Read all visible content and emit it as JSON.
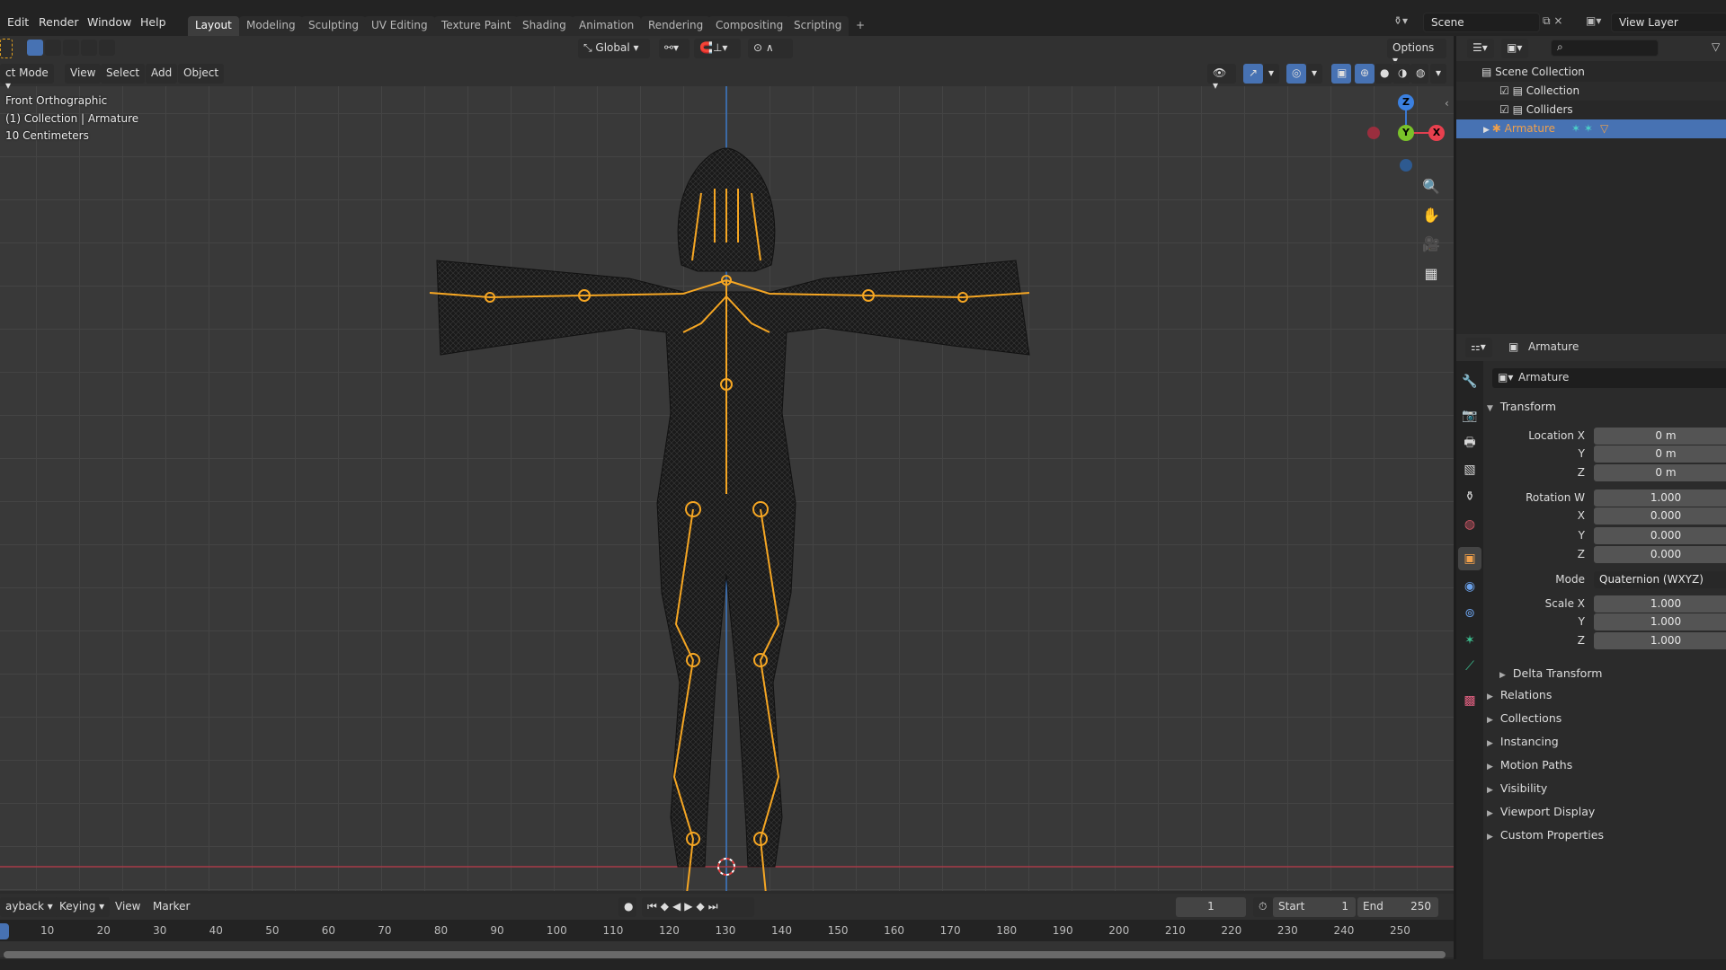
{
  "menus": [
    "Edit",
    "Render",
    "Window",
    "Help"
  ],
  "workspaces": [
    "Layout",
    "Modeling",
    "Sculpting",
    "UV Editing",
    "Texture Paint",
    "Shading",
    "Animation",
    "Rendering",
    "Compositing",
    "Scripting",
    "+"
  ],
  "active_workspace": "Layout",
  "scene": {
    "name": "Scene",
    "view_layer": "View Layer"
  },
  "toolbar": {
    "orientation": "Global",
    "options": "Options"
  },
  "viewport_header": {
    "mode": "ct Mode",
    "menus": [
      "View",
      "Select",
      "Add",
      "Object"
    ]
  },
  "viewport_overlay": {
    "view": "Front Orthographic",
    "collection": "(1) Collection | Armature",
    "scale": "10 Centimeters"
  },
  "gizmo": {
    "z": "Z",
    "y": "Y",
    "x": "X"
  },
  "timeline": {
    "menus": [
      "ayback",
      "Keying",
      "View",
      "Marker"
    ],
    "current_frame": "1",
    "start_label": "Start",
    "start": "1",
    "end_label": "End",
    "end": "250",
    "ticks": [
      "10",
      "20",
      "30",
      "40",
      "50",
      "60",
      "70",
      "80",
      "90",
      "100",
      "110",
      "120",
      "130",
      "140",
      "150",
      "160",
      "170",
      "180",
      "190",
      "200",
      "210",
      "220",
      "230",
      "240",
      "250"
    ]
  },
  "outliner": {
    "items": [
      {
        "label": "Scene Collection"
      },
      {
        "label": "Collection"
      },
      {
        "label": "Colliders"
      },
      {
        "label": "Armature",
        "selected": true
      }
    ]
  },
  "properties": {
    "header": "Armature",
    "object_name": "Armature",
    "transform_label": "Transform",
    "rows": [
      {
        "label": "Location X",
        "value": "0 m"
      },
      {
        "label": "Y",
        "value": "0 m"
      },
      {
        "label": "Z",
        "value": "0 m"
      },
      {
        "label": "Rotation W",
        "value": "1.000"
      },
      {
        "label": "X",
        "value": "0.000"
      },
      {
        "label": "Y",
        "value": "0.000"
      },
      {
        "label": "Z",
        "value": "0.000"
      },
      {
        "label": "Mode",
        "value": "Quaternion (WXYZ)"
      },
      {
        "label": "Scale X",
        "value": "1.000"
      },
      {
        "label": "Y",
        "value": "1.000"
      },
      {
        "label": "Z",
        "value": "1.000"
      }
    ],
    "delta": "Delta Transform",
    "sections": [
      "Relations",
      "Collections",
      "Instancing",
      "Motion Paths",
      "Visibility",
      "Viewport Display",
      "Custom Properties"
    ]
  },
  "colors": {
    "accent": "#4772b3",
    "bone": "#f5a623",
    "selected_text": "#f0a04b"
  }
}
